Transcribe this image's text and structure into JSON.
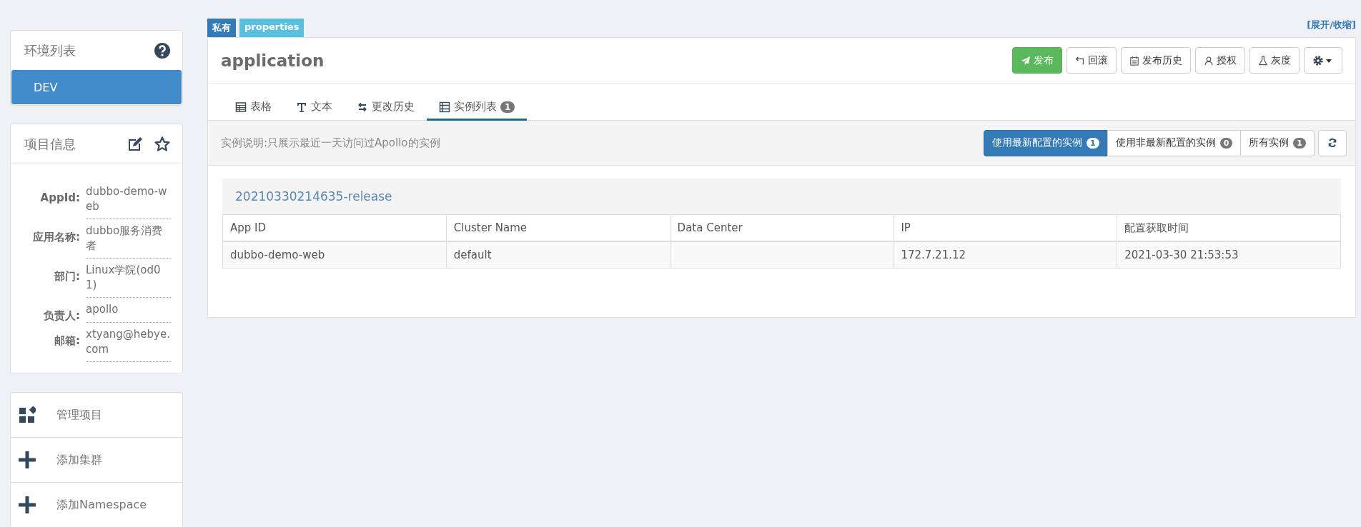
{
  "env_panel": {
    "title": "环境列表",
    "environments": [
      {
        "name": "DEV",
        "selected": true
      }
    ]
  },
  "project_info": {
    "title": "项目信息",
    "fields": [
      {
        "label": "AppId:",
        "value": "dubbo-demo-web"
      },
      {
        "label": "应用名称:",
        "value": "dubbo服务消费者"
      },
      {
        "label": "部门:",
        "value": "Linux学院(od01)"
      },
      {
        "label": "负责人:",
        "value": "apollo"
      },
      {
        "label": "邮箱:",
        "value": "xtyang@hebye.com"
      }
    ]
  },
  "actions": [
    {
      "kind": "manage",
      "label": "管理项目"
    },
    {
      "kind": "add",
      "label": "添加集群"
    },
    {
      "kind": "add",
      "label": "添加Namespace"
    }
  ],
  "namespace": {
    "tags": [
      {
        "kind": "scope",
        "label": "私有"
      },
      {
        "kind": "format",
        "label": "properties"
      }
    ],
    "toggle_link": "[展开/收缩]",
    "name": "application",
    "buttons": [
      {
        "kind": "publish",
        "label": "发布"
      },
      {
        "kind": "rollback",
        "label": "回滚"
      },
      {
        "kind": "history",
        "label": "发布历史"
      },
      {
        "kind": "grant",
        "label": "授权"
      },
      {
        "kind": "gray",
        "label": "灰度"
      },
      {
        "kind": "settings"
      }
    ],
    "tabs": [
      {
        "kind": "table",
        "label": "表格",
        "selected": false
      },
      {
        "kind": "text",
        "label": "文本",
        "selected": false
      },
      {
        "kind": "history",
        "label": "更改历史",
        "selected": false
      },
      {
        "kind": "instances",
        "label": "实例列表",
        "badge": "1",
        "selected": true
      }
    ],
    "instance_note": "实例说明:只展示最近一天访问过Apollo的实例",
    "filters": [
      {
        "label": "使用最新配置的实例",
        "count": "1",
        "selected": true
      },
      {
        "label": "使用非最新配置的实例",
        "count": "0",
        "selected": false
      },
      {
        "label": "所有实例",
        "count": "1",
        "selected": false
      }
    ],
    "release": {
      "title": "20210330214635-release",
      "columns": [
        "App ID",
        "Cluster Name",
        "Data Center",
        "IP",
        "配置获取时间"
      ],
      "rows": [
        [
          "dubbo-demo-web",
          "default",
          "",
          "172.7.21.12",
          "2021-03-30 21:53:53"
        ]
      ]
    }
  }
}
